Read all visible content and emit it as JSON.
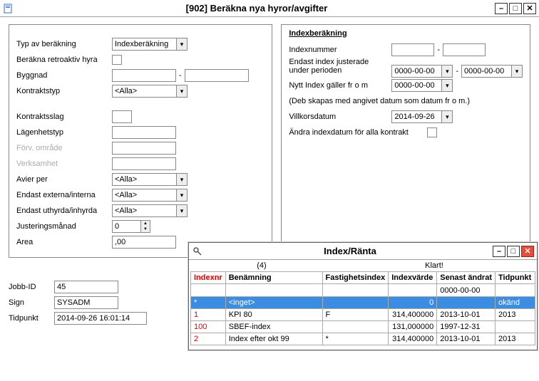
{
  "window": {
    "title": "[902]  Beräkna nya hyror/avgifter"
  },
  "left": {
    "typ_label": "Typ av beräkning",
    "typ_value": "Indexberäkning",
    "retro_label": "Beräkna retroaktiv hyra",
    "byggnad_label": "Byggnad",
    "dash": "-",
    "kontraktstyp_label": "Kontraktstyp",
    "kontraktstyp_value": "<Alla>",
    "kontraktsslag_label": "Kontraktsslag",
    "lagenhetstyp_label": "Lägenhetstyp",
    "forv_label": "Förv. område",
    "verksamhet_label": "Verksamhet",
    "avier_label": "Avier per",
    "avier_value": "<Alla>",
    "externa_label": "Endast externa/interna",
    "externa_value": "<Alla>",
    "uthyrda_label": "Endast uthyrda/inhyrda",
    "uthyrda_value": "<Alla>",
    "justerings_label": "Justeringsmånad",
    "justerings_value": "0",
    "area_label": "Area",
    "area_value": ",00"
  },
  "right": {
    "legend": "Indexberäkning",
    "indexnummer_label": "Indexnummer",
    "dash": "-",
    "endast_label1": "Endast index justerade",
    "endast_label2": "under perioden",
    "date_zero": "0000-00-00",
    "nytt_label": "Nytt Index gäller fr o m",
    "nytt_note": "(Deb skapas med angivet datum som datum fr o m.)",
    "villkor_label": "Villkorsdatum",
    "villkor_value": "2014-09-26",
    "andra_label": "Ändra indexdatum för alla kontrakt"
  },
  "bottom": {
    "jobbid_label": "Jobb-ID",
    "jobbid_value": "45",
    "sign_label": "Sign",
    "sign_value": "SYSADM",
    "tidpunkt_label": "Tidpunkt",
    "tidpunkt_value": "2014-09-26 16:01:14"
  },
  "sub": {
    "title": "Index/Ränta",
    "count": "(4)",
    "status": "Klart!",
    "headers": {
      "indexnr": "Indexnr",
      "benamning": "Benämning",
      "fastighetsindex": "Fastighetsindex",
      "indexvarde": "Indexvärde",
      "senast": "Senast ändrat",
      "tidpunkt": "Tidpunkt"
    },
    "filter_date": "0000-00-00",
    "rows": [
      {
        "nr": "*",
        "ben": "<inget>",
        "fi": "",
        "iv": "0",
        "sa": "",
        "tp": "okänd",
        "sel": true
      },
      {
        "nr": "1",
        "ben": "KPI 80",
        "fi": "F",
        "iv": "314,400000",
        "sa": "2013-10-01",
        "tp": "2013"
      },
      {
        "nr": "100",
        "ben": "SBEF-index",
        "fi": "",
        "iv": "131,000000",
        "sa": "1997-12-31",
        "tp": ""
      },
      {
        "nr": "2",
        "ben": "Index efter okt 99",
        "fi": "*",
        "iv": "314,400000",
        "sa": "2013-10-01",
        "tp": "2013"
      }
    ]
  }
}
